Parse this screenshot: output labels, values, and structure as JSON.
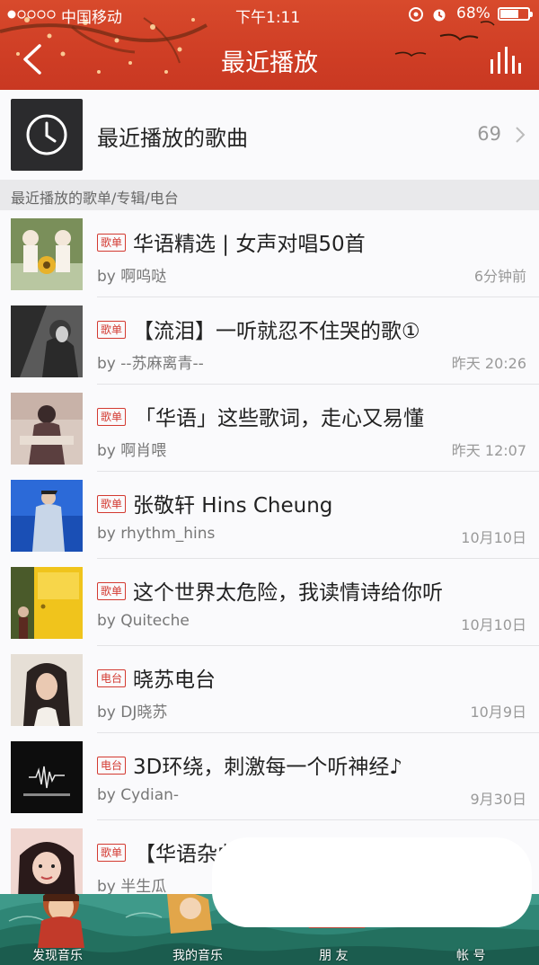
{
  "status_bar": {
    "carrier": "中国移动",
    "time": "下午1:11",
    "battery_pct": "68%",
    "battery_level": 0.68
  },
  "header": {
    "title": "最近播放",
    "back_icon": "chevron-left-icon",
    "nowplaying_icon": "equalizer-bars-icon"
  },
  "recent_songs": {
    "label": "最近播放的歌曲",
    "count": "69"
  },
  "section_header": "最近播放的歌单/专辑/电台",
  "items": [
    {
      "tag": "歌单",
      "title": "华语精选 | 女声对唱50首",
      "author": "by 啊呜哒",
      "time": "6分钟前"
    },
    {
      "tag": "歌单",
      "title": "【流泪】一听就忍不住哭的歌①",
      "author": "by --苏麻离青--",
      "time": "昨天 20:26"
    },
    {
      "tag": "歌单",
      "title": "「华语」这些歌词，走心又易懂",
      "author": "by 啊肖喂",
      "time": "昨天 12:07"
    },
    {
      "tag": "歌单",
      "title": "张敬轩 Hins Cheung",
      "author": "by rhythm_hins",
      "time": "10月10日"
    },
    {
      "tag": "歌单",
      "title": "这个世界太危险，我读情诗给你听",
      "author": "by Quiteche",
      "time": "10月10日"
    },
    {
      "tag": "电台",
      "title": "晓苏电台",
      "author": "by DJ晓苏",
      "time": "10月9日"
    },
    {
      "tag": "电台",
      "title": "3D环绕，刺激每一个听神经♪",
      "author": "by Cydian-",
      "time": "9月30日"
    },
    {
      "tag": "歌单",
      "title": "【华语杂曲",
      "author": "by 半生瓜",
      "time": ""
    }
  ],
  "tabbar": {
    "tabs": [
      {
        "label": "发现音乐"
      },
      {
        "label": "我的音乐"
      },
      {
        "label": "朋 友"
      },
      {
        "label": "帐 号"
      }
    ]
  },
  "colors": {
    "brand_red": "#d33a31",
    "header_red": "#cf3e25"
  }
}
